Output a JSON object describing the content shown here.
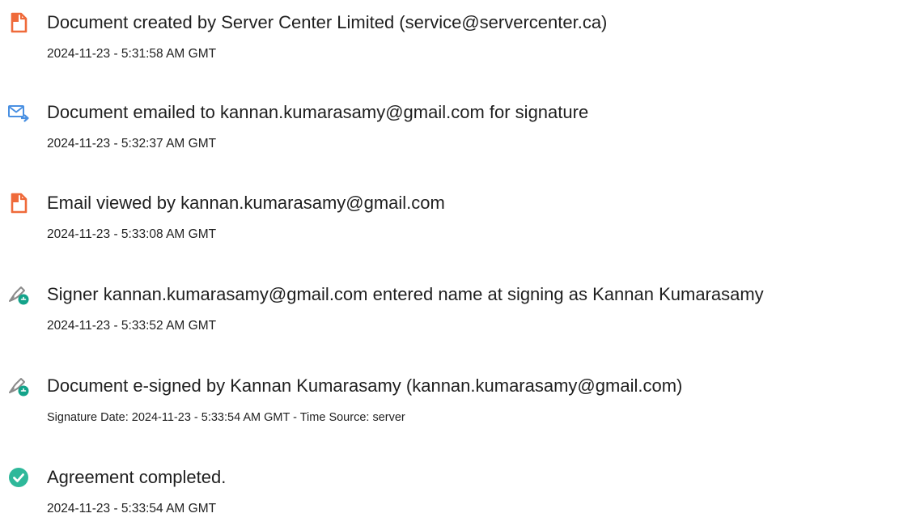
{
  "colors": {
    "document_icon": "#ef6a3a",
    "email_icon": "#4a90e2",
    "signature_pen": "#8a8a8a",
    "signature_badge": "#13a38a",
    "completed_badge": "#2eb89a"
  },
  "events": [
    {
      "icon": "document-icon",
      "title": "Document created by Server Center Limited (service@servercenter.ca)",
      "meta": "2024-11-23 - 5:31:58 AM GMT"
    },
    {
      "icon": "email-send-icon",
      "title": "Document emailed to kannan.kumarasamy@gmail.com for signature",
      "meta": "2024-11-23 - 5:32:37 AM GMT"
    },
    {
      "icon": "document-icon",
      "title": "Email viewed by kannan.kumarasamy@gmail.com",
      "meta": "2024-11-23 - 5:33:08 AM GMT"
    },
    {
      "icon": "signature-pen-icon",
      "title": "Signer kannan.kumarasamy@gmail.com entered name at signing as Kannan Kumarasamy",
      "meta": "2024-11-23 - 5:33:52 AM GMT"
    },
    {
      "icon": "signature-pen-icon",
      "title": "Document e-signed by Kannan Kumarasamy (kannan.kumarasamy@gmail.com)",
      "meta": "Signature Date: 2024-11-23 - 5:33:54 AM GMT - Time Source: server"
    },
    {
      "icon": "checkmark-circle-icon",
      "title": "Agreement completed.",
      "meta": "2024-11-23 - 5:33:54 AM GMT"
    }
  ]
}
